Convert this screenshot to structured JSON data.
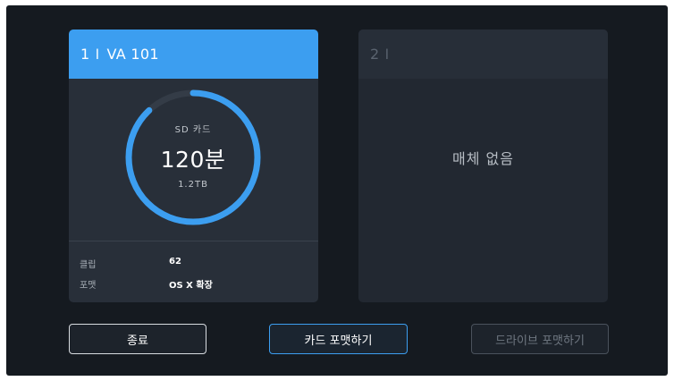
{
  "slot1": {
    "number": "1",
    "separator": "I",
    "name": "VA 101",
    "media_type": "SD 카드",
    "remaining": "120분",
    "capacity": "1.2TB",
    "remaining_fraction": 0.88,
    "info": [
      {
        "label": "클립",
        "value": "62"
      },
      {
        "label": "포맷",
        "value": "OS X 확장"
      }
    ]
  },
  "slot2": {
    "number": "2",
    "separator": "I",
    "status": "매체 없음"
  },
  "buttons": {
    "exit": "종료",
    "format_card": "카드 포맷하기",
    "format_drive": "드라이브 포맷하기"
  },
  "colors": {
    "accent": "#3c9ef0",
    "background": "#151a20",
    "card": "#282f39",
    "ring_track": "#343c47"
  }
}
